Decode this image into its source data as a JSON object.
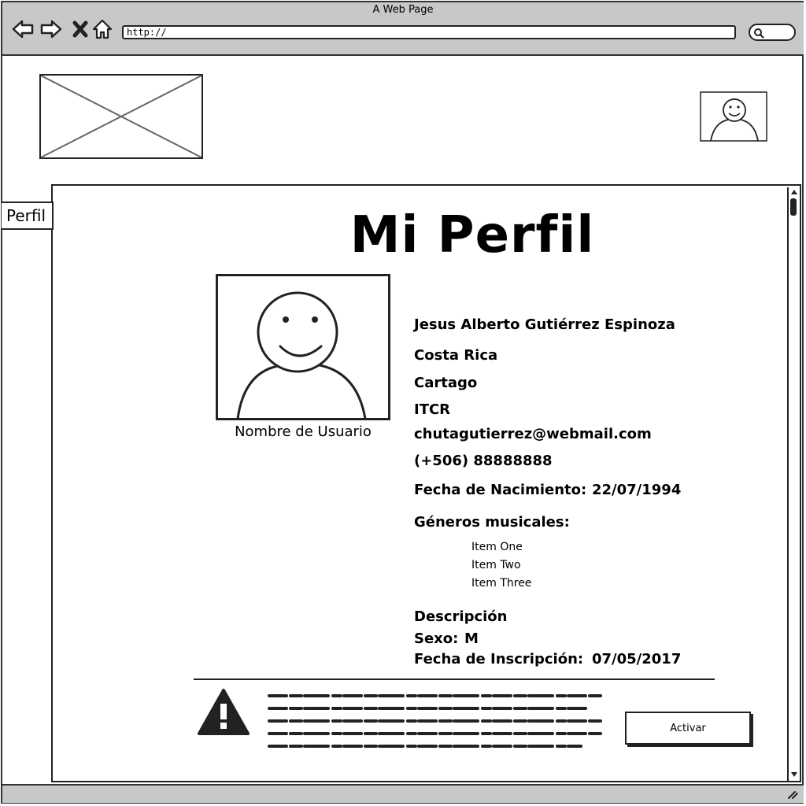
{
  "window": {
    "title": "A Web Page",
    "url": "http://"
  },
  "tabs": {
    "active_label": "Perfil"
  },
  "profile": {
    "page_title": "Mi Perfil",
    "username_caption": "Nombre de Usuario",
    "full_name": "Jesus Alberto Gutiérrez Espinoza",
    "country": "Costa Rica",
    "province": "Cartago",
    "institution": "ITCR",
    "email": "chutagutierrez@webmail.com",
    "phone": "(+506) 88888888",
    "birth_label": "Fecha de Nacimiento:",
    "birth_value": "22/07/1994",
    "genres_label": "Géneros musicales:",
    "genres": [
      "Item One",
      "Item Two",
      "Item Three"
    ],
    "description_label": "Descripción",
    "sex_label": "Sexo:",
    "sex_value": "M",
    "signup_label": "Fecha de Inscripción:",
    "signup_value": "07/05/2017"
  },
  "alert": {
    "icon": "warning-icon",
    "button_label": "Activar"
  },
  "icons": [
    "back-icon",
    "forward-icon",
    "close-icon",
    "home-icon",
    "search-icon",
    "avatar-icon",
    "image-placeholder-icon"
  ]
}
